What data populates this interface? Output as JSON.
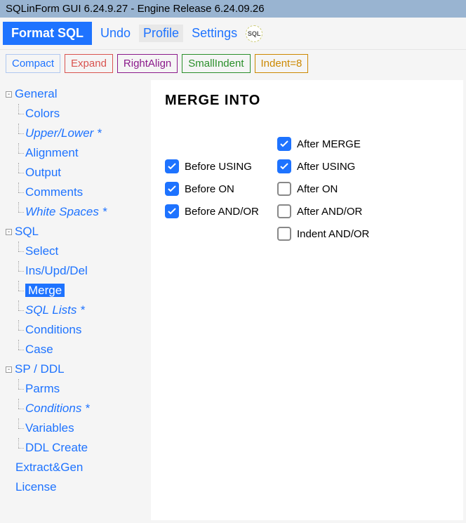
{
  "titlebar": "SQLinForm GUI 6.24.9.27 - Engine Release 6.24.09.26",
  "toolbar1": {
    "format": "Format SQL",
    "undo": "Undo",
    "profile": "Profile",
    "settings": "Settings",
    "logo_text": "SQL"
  },
  "toolbar2": {
    "compact": "Compact",
    "expand": "Expand",
    "rightalign": "RightAlign",
    "smallindent": "SmallIndent",
    "indent8": "Indent=8"
  },
  "tree": {
    "general": {
      "label": "General",
      "colors": "Colors",
      "upperlower": "Upper/Lower *",
      "alignment": "Alignment",
      "output": "Output",
      "comments": "Comments",
      "whitespaces": "White Spaces *"
    },
    "sql": {
      "label": "SQL",
      "select": "Select",
      "insupddel": "Ins/Upd/Del",
      "merge": "Merge",
      "sqllists": "SQL Lists *",
      "conditions": "Conditions",
      "case": "Case"
    },
    "spddl": {
      "label": "SP / DDL",
      "parms": "Parms",
      "conditions": "Conditions *",
      "variables": "Variables",
      "ddlcreate": "DDL Create"
    },
    "extractgen": "Extract&Gen",
    "license": "License"
  },
  "content": {
    "heading": "MERGE INTO",
    "checks": {
      "after_merge": {
        "label": "After MERGE",
        "checked": true
      },
      "before_using": {
        "label": "Before USING",
        "checked": true
      },
      "after_using": {
        "label": "After USING",
        "checked": true
      },
      "before_on": {
        "label": "Before ON",
        "checked": true
      },
      "after_on": {
        "label": "After ON",
        "checked": false
      },
      "before_andor": {
        "label": "Before AND/OR",
        "checked": true
      },
      "after_andor": {
        "label": "After AND/OR",
        "checked": false
      },
      "indent_andor": {
        "label": "Indent AND/OR",
        "checked": false
      }
    }
  }
}
